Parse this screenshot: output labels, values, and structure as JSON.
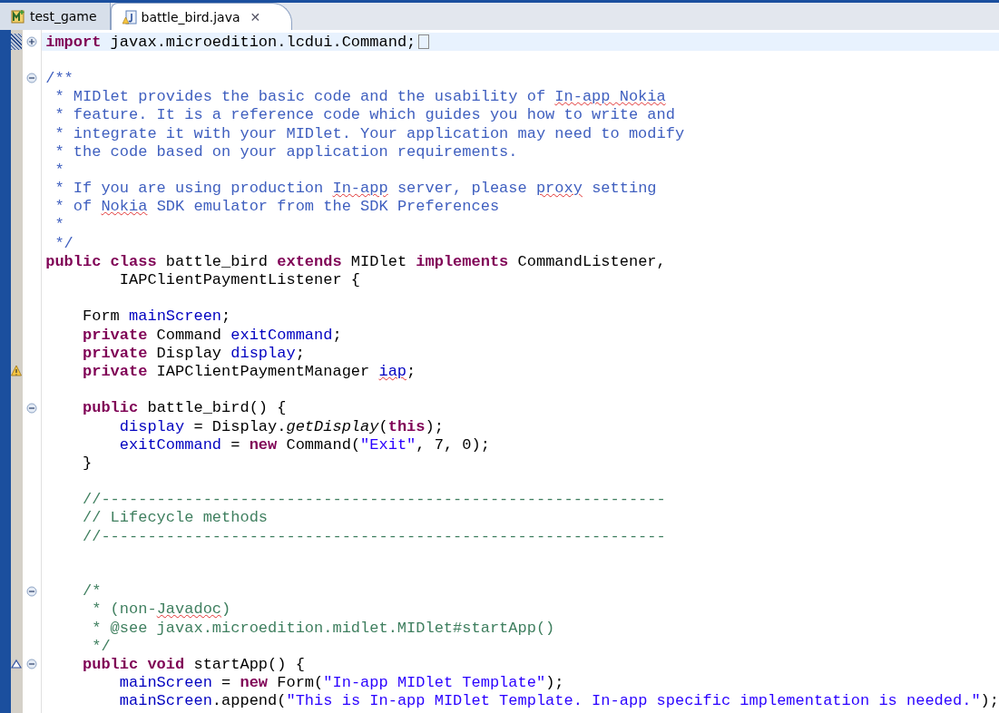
{
  "tabs": [
    {
      "label": "test_game",
      "kind": "midlet",
      "selected": false,
      "closable": false
    },
    {
      "label": "battle_bird.java",
      "kind": "java",
      "selected": true,
      "closable": true
    }
  ],
  "close_glyph": "✕",
  "lines": [
    {
      "kind": "code",
      "current": true,
      "expanded": false,
      "range": true,
      "folded": true,
      "tokens": [
        {
          "text": "import",
          "kind": "kw"
        },
        {
          "text": " javax.microedition.lcdui.Command;",
          "kind": "plain"
        }
      ]
    },
    {
      "kind": "blank"
    },
    {
      "kind": "code",
      "expanded": true,
      "tokens": [
        {
          "text": "/**",
          "kind": "doc"
        }
      ]
    },
    {
      "kind": "code",
      "tokens": [
        {
          "text": " * MIDlet provides the basic code and the usability of ",
          "kind": "doc"
        },
        {
          "text": "In-app Nokia",
          "kind": "doc",
          "squiggle": true
        }
      ]
    },
    {
      "kind": "code",
      "tokens": [
        {
          "text": " * feature. It is a reference code which guides you how to write and",
          "kind": "doc"
        }
      ]
    },
    {
      "kind": "code",
      "tokens": [
        {
          "text": " * integrate it with your MIDlet. Your application may need to modify",
          "kind": "doc"
        }
      ]
    },
    {
      "kind": "code",
      "tokens": [
        {
          "text": " * the code based on your application requirements.",
          "kind": "doc"
        }
      ]
    },
    {
      "kind": "code",
      "tokens": [
        {
          "text": " *",
          "kind": "doc"
        }
      ]
    },
    {
      "kind": "code",
      "tokens": [
        {
          "text": " * If you are using production ",
          "kind": "doc"
        },
        {
          "text": "In-app",
          "kind": "doc",
          "squiggle": true
        },
        {
          "text": " server, please ",
          "kind": "doc"
        },
        {
          "text": "proxy",
          "kind": "doc",
          "squiggle": true
        },
        {
          "text": " setting",
          "kind": "doc"
        }
      ]
    },
    {
      "kind": "code",
      "tokens": [
        {
          "text": " * of ",
          "kind": "doc"
        },
        {
          "text": "Nokia",
          "kind": "doc",
          "squiggle": true
        },
        {
          "text": " SDK emulator from the SDK Preferences",
          "kind": "doc"
        }
      ]
    },
    {
      "kind": "code",
      "tokens": [
        {
          "text": " *",
          "kind": "doc"
        }
      ]
    },
    {
      "kind": "code",
      "tokens": [
        {
          "text": " */",
          "kind": "doc"
        }
      ]
    },
    {
      "kind": "code",
      "tokens": [
        {
          "text": "public class",
          "kind": "kw"
        },
        {
          "text": " battle_bird ",
          "kind": "plain"
        },
        {
          "text": "extends",
          "kind": "kw"
        },
        {
          "text": " MIDlet ",
          "kind": "plain"
        },
        {
          "text": "implements",
          "kind": "kw"
        },
        {
          "text": " CommandListener,",
          "kind": "plain"
        }
      ]
    },
    {
      "kind": "code",
      "tokens": [
        {
          "text": "        IAPClientPaymentListener {",
          "kind": "plain"
        }
      ]
    },
    {
      "kind": "blank"
    },
    {
      "kind": "code",
      "tokens": [
        {
          "text": "    Form ",
          "kind": "plain"
        },
        {
          "text": "mainScreen",
          "kind": "field"
        },
        {
          "text": ";",
          "kind": "plain"
        }
      ]
    },
    {
      "kind": "code",
      "tokens": [
        {
          "text": "    private",
          "kind": "kw"
        },
        {
          "text": " Command ",
          "kind": "plain"
        },
        {
          "text": "exitCommand",
          "kind": "field"
        },
        {
          "text": ";",
          "kind": "plain"
        }
      ]
    },
    {
      "kind": "code",
      "tokens": [
        {
          "text": "    private",
          "kind": "kw"
        },
        {
          "text": " Display ",
          "kind": "plain"
        },
        {
          "text": "display",
          "kind": "field"
        },
        {
          "text": ";",
          "kind": "plain"
        }
      ]
    },
    {
      "kind": "code",
      "warning": true,
      "tokens": [
        {
          "text": "    private",
          "kind": "kw"
        },
        {
          "text": " IAPClientPaymentManager ",
          "kind": "plain"
        },
        {
          "text": "iap",
          "kind": "field",
          "squiggle": true
        },
        {
          "text": ";",
          "kind": "plain"
        }
      ]
    },
    {
      "kind": "blank"
    },
    {
      "kind": "code",
      "expanded": true,
      "tokens": [
        {
          "text": "    public",
          "kind": "kw"
        },
        {
          "text": " battle_bird() {",
          "kind": "plain"
        }
      ]
    },
    {
      "kind": "code",
      "tokens": [
        {
          "text": "        display",
          "kind": "field"
        },
        {
          "text": " = Display.",
          "kind": "plain"
        },
        {
          "text": "getDisplay",
          "kind": "italic"
        },
        {
          "text": "(",
          "kind": "plain"
        },
        {
          "text": "this",
          "kind": "kw"
        },
        {
          "text": ");",
          "kind": "plain"
        }
      ]
    },
    {
      "kind": "code",
      "tokens": [
        {
          "text": "        exitCommand",
          "kind": "field"
        },
        {
          "text": " = ",
          "kind": "plain"
        },
        {
          "text": "new",
          "kind": "kw"
        },
        {
          "text": " Command(",
          "kind": "plain"
        },
        {
          "text": "\"Exit\"",
          "kind": "string"
        },
        {
          "text": ", 7, 0);",
          "kind": "plain"
        }
      ]
    },
    {
      "kind": "code",
      "tokens": [
        {
          "text": "    }",
          "kind": "plain"
        }
      ]
    },
    {
      "kind": "blank"
    },
    {
      "kind": "code",
      "tokens": [
        {
          "text": "    //-------------------------------------------------------------",
          "kind": "comment"
        }
      ]
    },
    {
      "kind": "code",
      "tokens": [
        {
          "text": "    // Lifecycle methods",
          "kind": "comment"
        }
      ]
    },
    {
      "kind": "code",
      "tokens": [
        {
          "text": "    //-------------------------------------------------------------",
          "kind": "comment"
        }
      ]
    },
    {
      "kind": "blank"
    },
    {
      "kind": "blank"
    },
    {
      "kind": "code",
      "expanded": true,
      "tokens": [
        {
          "text": "    /*",
          "kind": "comment"
        }
      ]
    },
    {
      "kind": "code",
      "tokens": [
        {
          "text": "     * (non-",
          "kind": "comment"
        },
        {
          "text": "Javadoc",
          "kind": "comment",
          "squiggle": true
        },
        {
          "text": ")",
          "kind": "comment"
        }
      ]
    },
    {
      "kind": "code",
      "tokens": [
        {
          "text": "     * @see javax.microedition.midlet.MIDlet#startApp()",
          "kind": "comment"
        }
      ]
    },
    {
      "kind": "code",
      "tokens": [
        {
          "text": "     */",
          "kind": "comment"
        }
      ]
    },
    {
      "kind": "code",
      "expanded": true,
      "override": true,
      "tokens": [
        {
          "text": "    public void",
          "kind": "kw"
        },
        {
          "text": " startApp() {",
          "kind": "plain"
        }
      ]
    },
    {
      "kind": "code",
      "tokens": [
        {
          "text": "        mainScreen",
          "kind": "field"
        },
        {
          "text": " = ",
          "kind": "plain"
        },
        {
          "text": "new",
          "kind": "kw"
        },
        {
          "text": " Form(",
          "kind": "plain"
        },
        {
          "text": "\"In-app MIDlet Template\"",
          "kind": "string"
        },
        {
          "text": ");",
          "kind": "plain"
        }
      ]
    },
    {
      "kind": "code",
      "tokens": [
        {
          "text": "        mainScreen",
          "kind": "field"
        },
        {
          "text": ".append(",
          "kind": "plain"
        },
        {
          "text": "\"This is In-app MIDlet Template. In-app specific implementation is needed.\"",
          "kind": "string"
        },
        {
          "text": ");",
          "kind": "plain"
        }
      ]
    }
  ]
}
